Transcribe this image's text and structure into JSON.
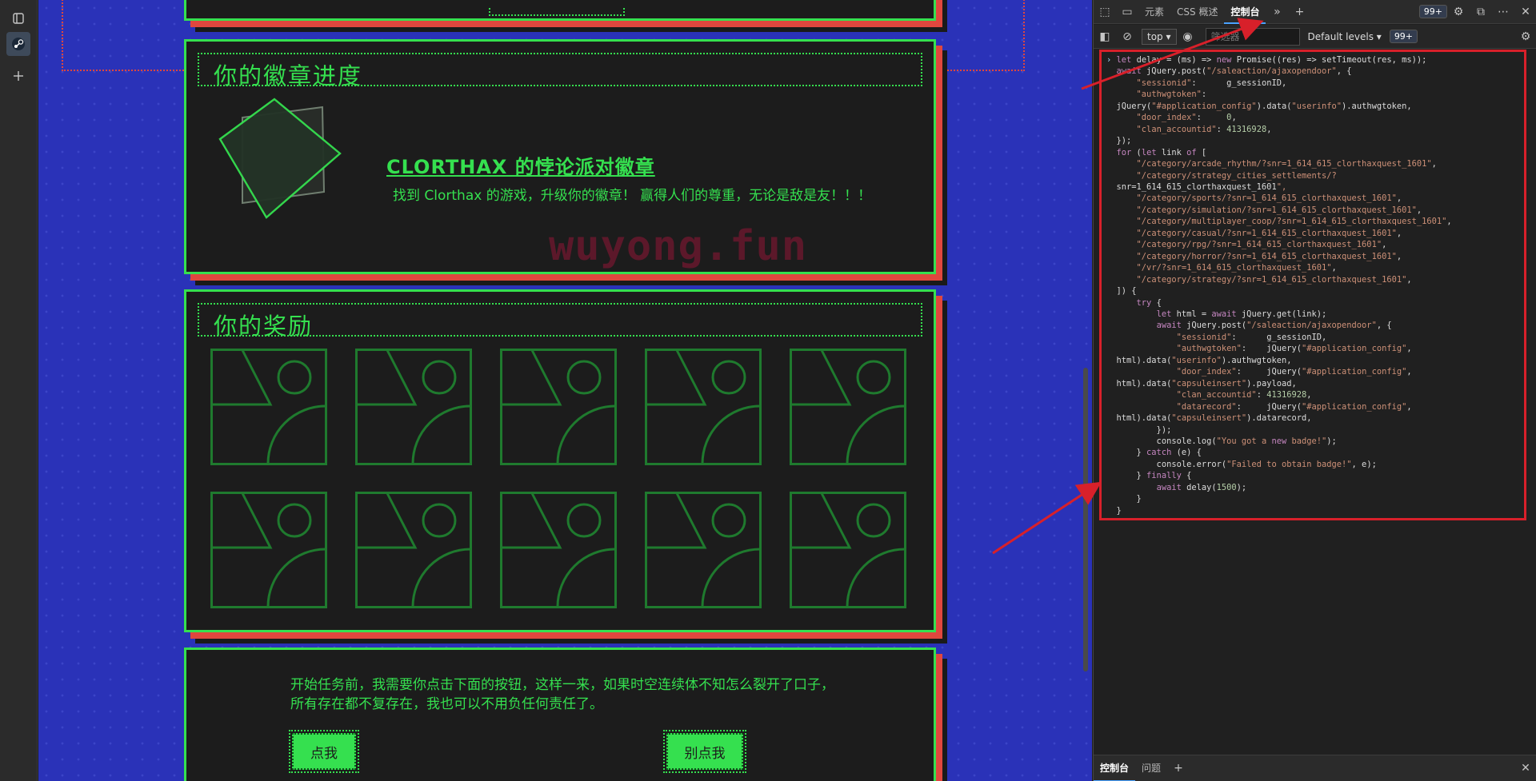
{
  "tabstrip": {
    "icons": [
      "tabs-icon",
      "steam-icon",
      "new-tab-icon"
    ]
  },
  "page": {
    "watermark": "wuyong.fun",
    "badge_panel": {
      "title": "你的徽章进度",
      "badge_name": "CLORTHAX 的悖论派对徽章",
      "badge_desc": "找到 Clorthax 的游戏，升级你的徽章！ 赢得人们的尊重，无论是敌是友！！！"
    },
    "rewards_panel": {
      "title": "你的奖励",
      "placeholder_count": 10
    },
    "task_panel": {
      "text": "开始任务前，我需要你点击下面的按钮，这样一来，如果时空连续体不知怎么裂开了口子，所有存在都不复存在，我也可以不用负任何责任了。",
      "click_button": "点我",
      "dont_click_button": "别点我"
    }
  },
  "devtools": {
    "tabs": [
      "元素",
      "CSS 概述",
      "控制台"
    ],
    "active_tab": "控制台",
    "badge_count": "99+",
    "context": "top",
    "filter_placeholder": "筛选器",
    "levels": "Default levels",
    "filter_badge": "99+",
    "drawer_tabs": [
      "控制台",
      "问题"
    ],
    "code_lines": [
      "let delay = (ms) => new Promise((res) => setTimeout(res, ms));",
      "await jQuery.post(\"/saleaction/ajaxopendoor\", {",
      "    \"sessionid\":      g_sessionID,",
      "    \"authwgtoken\":",
      "jQuery(\"#application_config\").data(\"userinfo\").authwgtoken,",
      "    \"door_index\":     0,",
      "    \"clan_accountid\": 41316928,",
      "});",
      "for (let link of [",
      "    \"/category/arcade_rhythm/?snr=1_614_615_clorthaxquest_1601\",",
      "    \"/category/strategy_cities_settlements/?",
      "snr=1_614_615_clorthaxquest_1601\",",
      "    \"/category/sports/?snr=1_614_615_clorthaxquest_1601\",",
      "    \"/category/simulation/?snr=1_614_615_clorthaxquest_1601\",",
      "    \"/category/multiplayer_coop/?snr=1_614_615_clorthaxquest_1601\",",
      "    \"/category/casual/?snr=1_614_615_clorthaxquest_1601\",",
      "    \"/category/rpg/?snr=1_614_615_clorthaxquest_1601\",",
      "    \"/category/horror/?snr=1_614_615_clorthaxquest_1601\",",
      "    \"/vr/?snr=1_614_615_clorthaxquest_1601\",",
      "    \"/category/strategy/?snr=1_614_615_clorthaxquest_1601\",",
      "]) {",
      "    try {",
      "        let html = await jQuery.get(link);",
      "        await jQuery.post(\"/saleaction/ajaxopendoor\", {",
      "            \"sessionid\":      g_sessionID,",
      "            \"authwgtoken\":    jQuery(\"#application_config\",",
      "html).data(\"userinfo\").authwgtoken,",
      "            \"door_index\":     jQuery(\"#application_config\",",
      "html).data(\"capsuleinsert\").payload,",
      "            \"clan_accountid\": 41316928,",
      "            \"datarecord\":     jQuery(\"#application_config\",",
      "html).data(\"capsuleinsert\").datarecord,",
      "        });",
      "        console.log(\"You got a new badge!\");",
      "    } catch (e) {",
      "        console.error(\"Failed to obtain badge!\", e);",
      "    } finally {",
      "        await delay(1500);",
      "    }",
      "}"
    ]
  },
  "colors": {
    "neon_green": "#35e04f",
    "accent_red": "#e0473e",
    "page_blue": "#2a32b8",
    "annotation_red": "#d8202a"
  }
}
